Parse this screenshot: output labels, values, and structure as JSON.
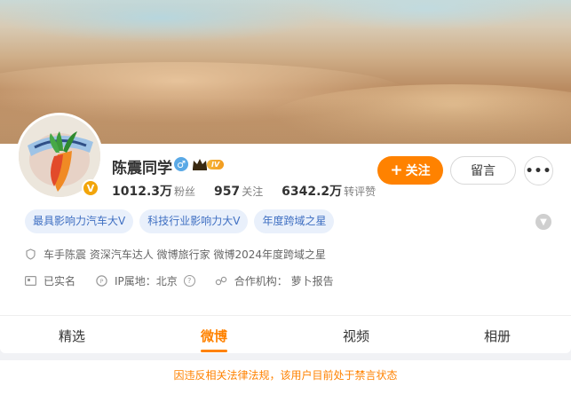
{
  "profile": {
    "name": "陈震同学",
    "level_badge": "IV",
    "followers": {
      "value": "1012.3万",
      "label": "粉丝"
    },
    "following": {
      "value": "957",
      "label": "关注"
    },
    "likes": {
      "value": "6342.2万",
      "label": "转评赞"
    }
  },
  "actions": {
    "follow_label": "关注",
    "message_label": "留言",
    "more_label": "•••"
  },
  "tags": [
    "最具影响力汽车大V",
    "科技行业影响力大V",
    "年度跨域之星"
  ],
  "info": {
    "bio": "车手陈震 资深汽车达人 微博旅行家 微博2024年度跨域之星",
    "verified": "已实名",
    "ip_location": "IP属地：北京",
    "cooperation": "合作机构：  萝卜报告"
  },
  "tabs": [
    "精选",
    "微博",
    "视频",
    "相册"
  ],
  "active_tab": "微博",
  "notice": "因违反相关法律法规，该用户目前处于禁言状态",
  "colors": {
    "accent": "#ff8200",
    "tag_text": "#3f6fc2",
    "tag_bg": "#e9f0fb"
  }
}
